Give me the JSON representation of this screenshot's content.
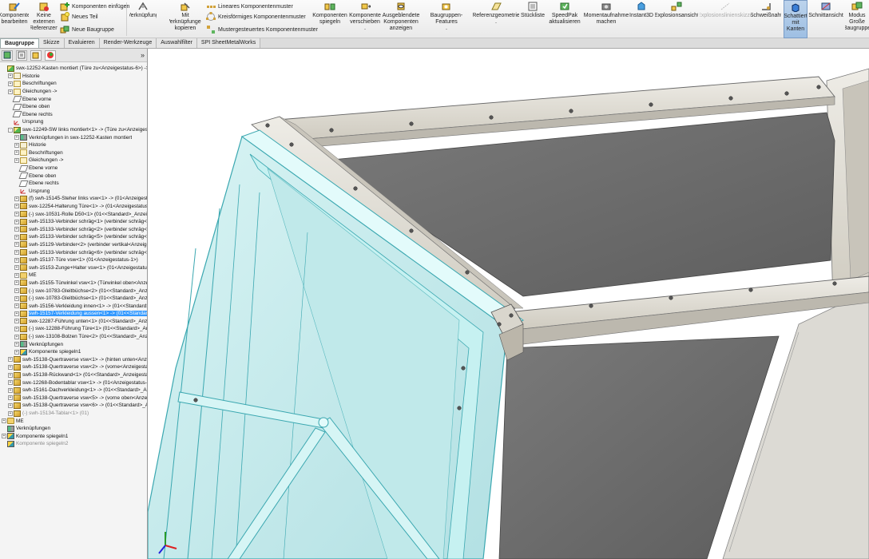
{
  "ribbon": {
    "komponente_bearbeiten": "Komponente bearbeiten",
    "keine_externen": "Keine externen Referenzen",
    "komponenten_einfuegen": "Komponenten einfügen",
    "neues_teil": "Neues Teil",
    "neue_baugruppe": "Neue Baugruppe",
    "verknuepfung": "Verknüpfung",
    "mit_verkn": "Mit Verknüpfungen kopieren",
    "lineares": "Lineares Komponentenmuster",
    "kreisfoermiges": "Kreisförmiges Komponentenmuster",
    "mustergesteuertes": "Mustergesteuertes Komponentenmuster",
    "komponenten_spiegeln": "Komponenten spiegeln",
    "komponente_verschieben": "Komponente verschieben",
    "ausgeblendete": "Ausgeblendete Komponenten anzeigen",
    "baugruppen_features": "Baugruppen-Features",
    "referenzgeometrie": "Referenzgeometrie",
    "stueckliste": "Stückliste",
    "speedpak": "SpeedPak aktualisieren",
    "momentaufnahme": "Momentaufnahme machen",
    "instant3d": "Instant3D",
    "explosionsansicht": "Explosionsansicht",
    "explosionslinienskizze": "Explosionslinienskizze",
    "schweissnaht": "Schweißnaht",
    "schattiert": "Schattiert mit Kanten",
    "schnittansicht": "Schnittansicht",
    "modus": "Modus Große Baugruppe",
    "dropdown_mark": "▾",
    "dash": "-"
  },
  "tabs": [
    "Baugruppe",
    "Skizze",
    "Evaluieren",
    "Render-Werkzeuge",
    "Auswahlfilter",
    "SPI SheetMetalWorks"
  ],
  "panel": {
    "expand_glyph": "»"
  },
  "tree": [
    {
      "d": 0,
      "ex": "",
      "ic": "asm",
      "t": "swx-12252-Kasten montiert  (Türe zu<Anzeigestatus-6>) ->"
    },
    {
      "d": 1,
      "ex": "+",
      "ic": "hist",
      "t": "Historie"
    },
    {
      "d": 1,
      "ex": "+",
      "ic": "A",
      "t": "Beschriftungen"
    },
    {
      "d": 1,
      "ex": "+",
      "ic": "A",
      "t": "Gleichungen ->"
    },
    {
      "d": 1,
      "ex": "",
      "ic": "plane",
      "t": "Ebene vorne"
    },
    {
      "d": 1,
      "ex": "",
      "ic": "plane",
      "t": "Ebene oben"
    },
    {
      "d": 1,
      "ex": "",
      "ic": "plane",
      "t": "Ebene rechts"
    },
    {
      "d": 1,
      "ex": "",
      "ic": "orig",
      "t": "Ursprung"
    },
    {
      "d": 1,
      "ex": "-",
      "ic": "asm",
      "t": "swx-12249-SW links montiert<1> -> (Türe zu<Anzeigestat"
    },
    {
      "d": 2,
      "ex": "+",
      "ic": "mate",
      "t": "Verknüpfungen in swx-12252-Kasten montiert"
    },
    {
      "d": 2,
      "ex": "+",
      "ic": "hist",
      "t": "Historie"
    },
    {
      "d": 2,
      "ex": "+",
      "ic": "A",
      "t": "Beschriftungen"
    },
    {
      "d": 2,
      "ex": "+",
      "ic": "A",
      "t": "Gleichungen ->"
    },
    {
      "d": 2,
      "ex": "",
      "ic": "plane",
      "t": "Ebene vorne"
    },
    {
      "d": 2,
      "ex": "",
      "ic": "plane",
      "t": "Ebene oben"
    },
    {
      "d": 2,
      "ex": "",
      "ic": "plane",
      "t": "Ebene rechts"
    },
    {
      "d": 2,
      "ex": "",
      "ic": "orig",
      "t": "Ursprung"
    },
    {
      "d": 2,
      "ex": "+",
      "ic": "part",
      "t": "(f) swh-15145-Steher links vsw<1> -> (01<Anzeigestatus"
    },
    {
      "d": 2,
      "ex": "+",
      "ic": "part",
      "t": "swx-12254-Halterung Türe<1> -> (01<Anzeigestatus-1"
    },
    {
      "d": 2,
      "ex": "+",
      "ic": "part",
      "t": "(-) swx-10531-Rolle D50<1> (01<<Standard>_Anzeigest"
    },
    {
      "d": 2,
      "ex": "+",
      "ic": "part",
      "t": "swh-15133-Verbinder schräg<1> (verbinder schräg<Anz"
    },
    {
      "d": 2,
      "ex": "+",
      "ic": "part",
      "t": "swh-15133-Verbinder schräg<2> (verbinder schräg<Anz"
    },
    {
      "d": 2,
      "ex": "+",
      "ic": "part",
      "t": "swh-15133-Verbinder schräg<5> (verbinder schräg<Anz"
    },
    {
      "d": 2,
      "ex": "+",
      "ic": "part",
      "t": "swh-15129-Verbinder<2> (verbinder vertikal<Anzeigest"
    },
    {
      "d": 2,
      "ex": "+",
      "ic": "part",
      "t": "swh-15133-Verbinder schräg<6> (verbinder schräg<Anz"
    },
    {
      "d": 2,
      "ex": "+",
      "ic": "part",
      "t": "swh-15137-Türe vsw<1> (01<Anzeigestatus-1>)"
    },
    {
      "d": 2,
      "ex": "+",
      "ic": "part",
      "t": "swh-15153-Zunge+Halter vsw<1> (01<Anzeigestatus-1"
    },
    {
      "d": 2,
      "ex": "+",
      "ic": "fold",
      "t": "ME"
    },
    {
      "d": 2,
      "ex": "+",
      "ic": "part",
      "t": "swh-15155-Türwinkel vsw<1> (Türwinkel oben<Anzeige"
    },
    {
      "d": 2,
      "ex": "+",
      "ic": "part",
      "t": "(-) swx-10783-Gleitbüchse<2> (01<<Standard>_Anzeige"
    },
    {
      "d": 2,
      "ex": "+",
      "ic": "part",
      "t": "(-) swx-10783-Gleitbüchse<1> (01<<Standard>_Anzeige"
    },
    {
      "d": 2,
      "ex": "+",
      "ic": "part",
      "t": "swh-15156-Verkleidung innen<1> -> (01<<Standard>_A"
    },
    {
      "d": 2,
      "ex": "+",
      "ic": "part",
      "t": "swh-15157-Verkleidung aussen<1> -> (01<<Standard>",
      "sel": true
    },
    {
      "d": 2,
      "ex": "+",
      "ic": "part",
      "t": "swx-12287-Führung unten<1> (01<<Standard>_Anzeige"
    },
    {
      "d": 2,
      "ex": "+",
      "ic": "part",
      "t": "(-) swx-12288-Führung Türe<1> (01<<Standard>_Anzei"
    },
    {
      "d": 2,
      "ex": "+",
      "ic": "part",
      "t": "(-) swx-13108-Bolzen Türe<2> (01<<Standard>_Anzei"
    },
    {
      "d": 2,
      "ex": "+",
      "ic": "mate",
      "t": "Verknüpfungen"
    },
    {
      "d": 2,
      "ex": "+",
      "ic": "mir",
      "t": "Komponente spiegeln1"
    },
    {
      "d": 1,
      "ex": "+",
      "ic": "part",
      "t": "swh-15138-Quertraverse vsw<1> -> (hinten unten<Anzeige"
    },
    {
      "d": 1,
      "ex": "+",
      "ic": "part",
      "t": "swh-15138-Quertraverse vsw<2> -> (vorne<Anzeigestatus"
    },
    {
      "d": 1,
      "ex": "+",
      "ic": "part",
      "t": "swh-15138-Rückwand<1> (01<<Standard>_Anzeigestatus 1"
    },
    {
      "d": 1,
      "ex": "+",
      "ic": "part",
      "t": "swx-12268-Bodentablar vsw<1> -> (01<Anzeigestatus-1>)"
    },
    {
      "d": 1,
      "ex": "+",
      "ic": "part",
      "t": "swh-15161-Dachverkleidung<1> -> (01<<Standard>_Anzei"
    },
    {
      "d": 1,
      "ex": "+",
      "ic": "part",
      "t": "swh-15138-Quertraverse vsw<5> -> (vorne oben<Anzeigest"
    },
    {
      "d": 1,
      "ex": "+",
      "ic": "part",
      "t": "swh-15138-Quertraverse vsw<6> -> (01<<Standard>_Anzeig"
    },
    {
      "d": 1,
      "ex": "+",
      "ic": "part",
      "t": "(-) swh-15134-Tablar<1> (01)",
      "grey": true
    },
    {
      "d": 0,
      "ex": "+",
      "ic": "fold",
      "t": "ME"
    },
    {
      "d": 0,
      "ex": "",
      "ic": "mate",
      "t": "Verknüpfungen"
    },
    {
      "d": 0,
      "ex": "+",
      "ic": "mir",
      "t": "Komponente spiegeln1"
    },
    {
      "d": 0,
      "ex": "",
      "ic": "mir",
      "t": "Komponente spiegeln2",
      "grey": true
    }
  ],
  "colors": {
    "frame_cyan": "#c6f1f1",
    "frame_stroke": "#3aa7b0",
    "panel_grey": "#6b6b6b",
    "beam": "#e4e1d8",
    "selection": "#3399ff"
  }
}
